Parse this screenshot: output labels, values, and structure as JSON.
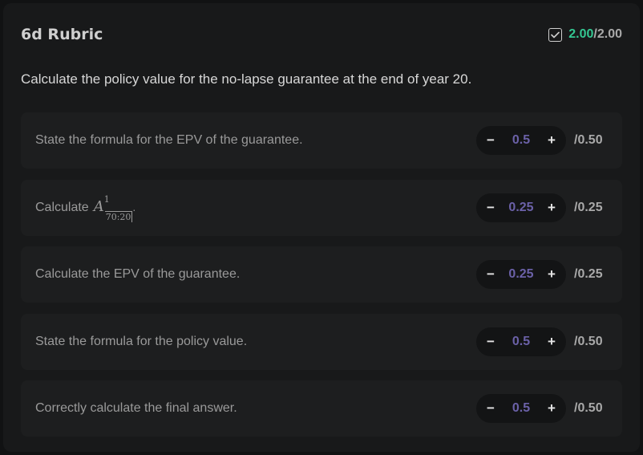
{
  "header": {
    "title": "6d Rubric",
    "score_earned": "2.00",
    "score_total": "/2.00",
    "icon": "checkbox-checked-icon",
    "colors": {
      "earned": "#34c792",
      "value": "#6b61a8"
    }
  },
  "question": "Calculate the policy value for the no-lapse guarantee at the end of year 20.",
  "criteria": [
    {
      "label": "State the formula for the EPV of the guarantee.",
      "value": "0.5",
      "max": "/0.50",
      "minus": "−",
      "plus": "+"
    },
    {
      "label": "Calculate",
      "math": {
        "base": "A",
        "sup": "1",
        "sub": "70:20"
      },
      "suffix": ".",
      "value": "0.25",
      "max": "/0.25",
      "minus": "−",
      "plus": "+"
    },
    {
      "label": "Calculate the EPV of the guarantee.",
      "value": "0.25",
      "max": "/0.25",
      "minus": "−",
      "plus": "+"
    },
    {
      "label": "State the formula for the policy value.",
      "value": "0.5",
      "max": "/0.50",
      "minus": "−",
      "plus": "+"
    },
    {
      "label": "Correctly calculate the final answer.",
      "value": "0.5",
      "max": "/0.50",
      "minus": "−",
      "plus": "+"
    }
  ]
}
